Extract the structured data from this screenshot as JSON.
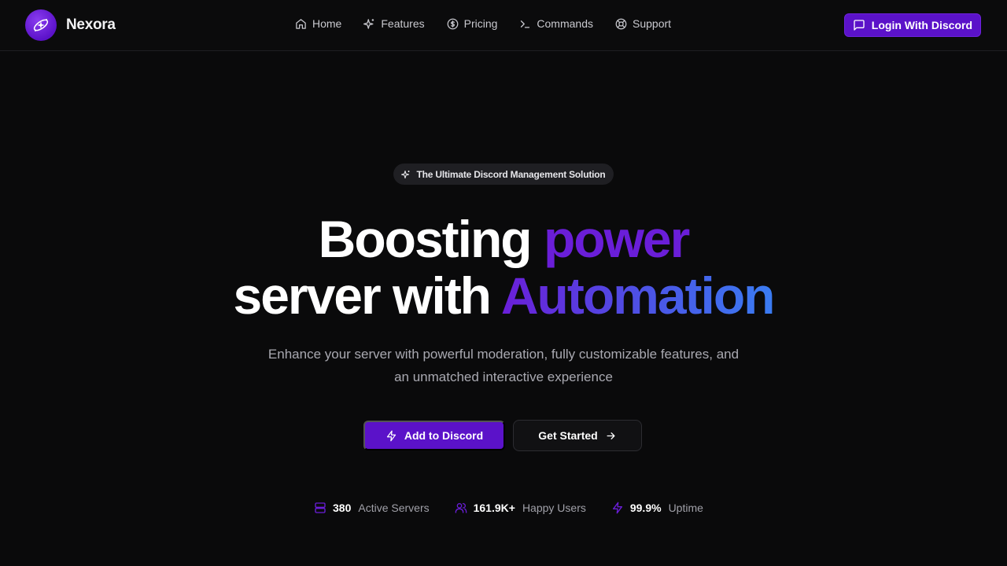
{
  "brand": {
    "name": "Nexora",
    "logo_icon": "sparkle-orbit-icon"
  },
  "nav": {
    "items": [
      {
        "label": "Home",
        "icon": "home-icon"
      },
      {
        "label": "Features",
        "icon": "sparkle-icon"
      },
      {
        "label": "Pricing",
        "icon": "dollar-circle-icon"
      },
      {
        "label": "Commands",
        "icon": "terminal-icon"
      },
      {
        "label": "Support",
        "icon": "lifebuoy-icon"
      }
    ],
    "login_label": "Login With Discord"
  },
  "hero": {
    "badge": "The Ultimate Discord Management Solution",
    "headline_line1_a": "Boosting ",
    "headline_line1_b": "power",
    "headline_line2_a": "server with ",
    "headline_line2_b": "Automation",
    "subtext": "Enhance your server with powerful moderation, fully customizable features, and an unmatched interactive experience",
    "primary_cta": "Add to Discord",
    "secondary_cta": "Get Started"
  },
  "stats": [
    {
      "value": "380",
      "label": "Active Servers",
      "icon": "server-icon"
    },
    {
      "value": "161.9K+",
      "label": "Happy Users",
      "icon": "users-icon"
    },
    {
      "value": "99.9%",
      "label": "Uptime",
      "icon": "bolt-icon"
    }
  ],
  "colors": {
    "background": "#0a0a0b",
    "primary": "#5b12c9",
    "accent_purple": "#6a1ed8",
    "accent_blue": "#3a7cf2",
    "muted_text": "#a9a9b1"
  }
}
